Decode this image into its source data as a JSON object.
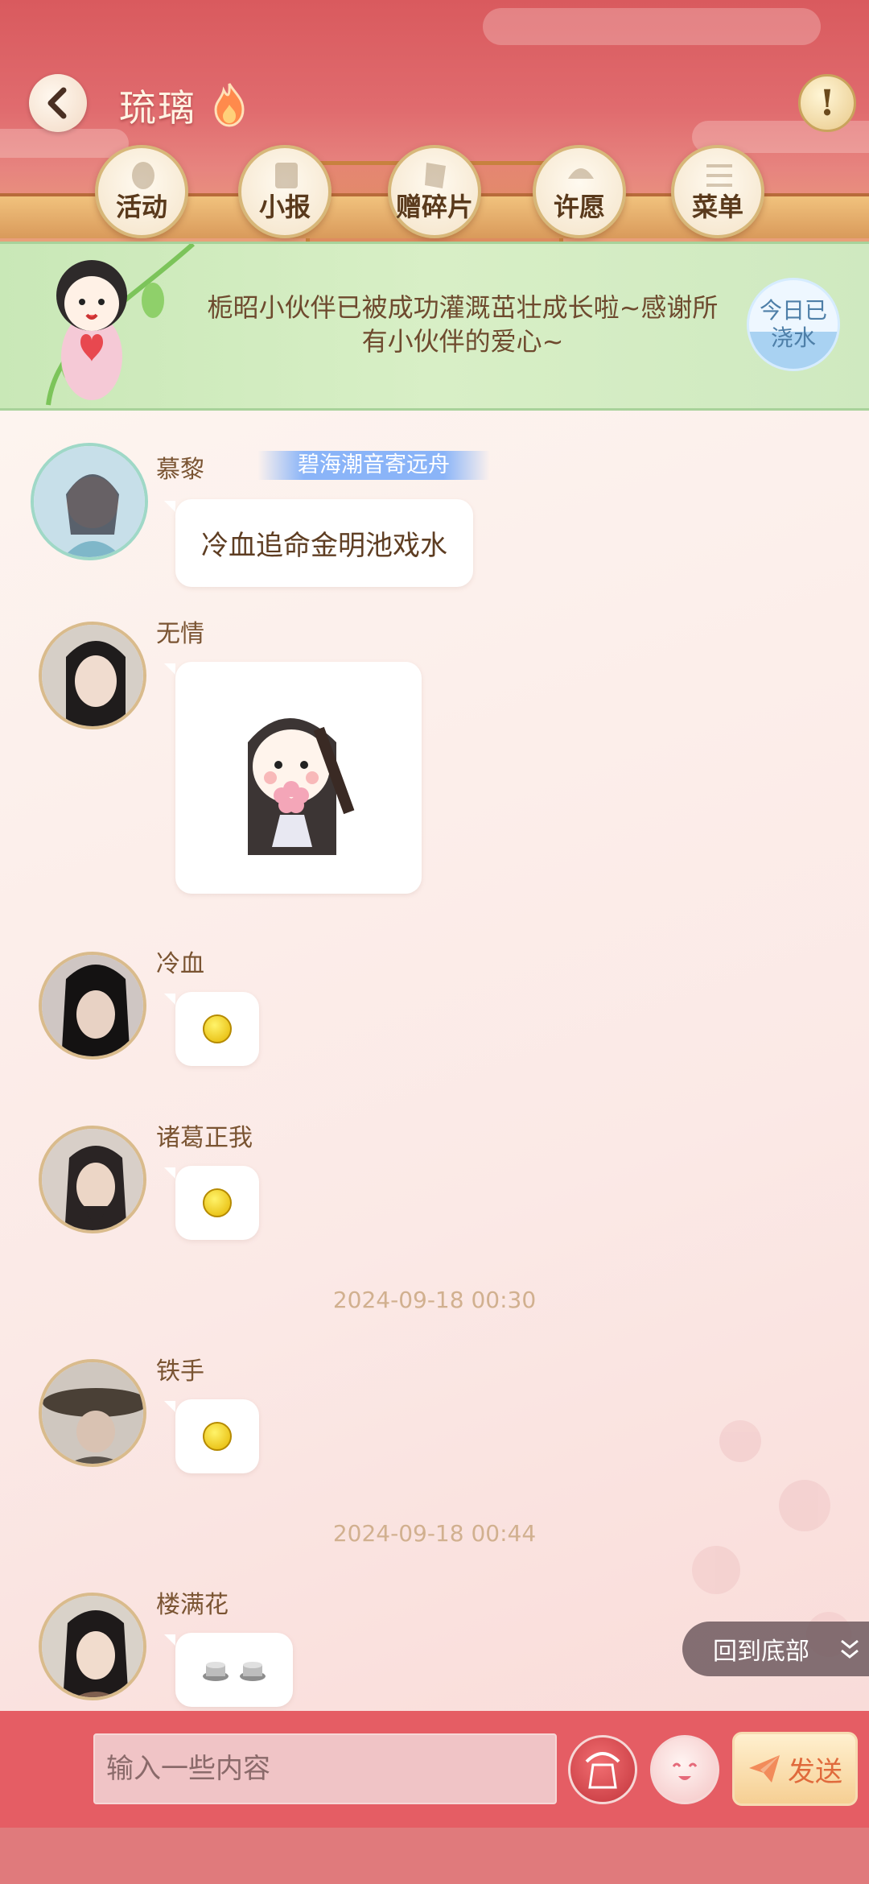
{
  "header": {
    "title": "琉璃",
    "back_icon": "back-arrow-icon",
    "alert_icon": "exclamation-icon",
    "alert_label": "!",
    "nav": [
      {
        "label": "活动",
        "icon": "lantern-icon"
      },
      {
        "label": "小报",
        "icon": "scroll-icon"
      },
      {
        "label": "赠碎片",
        "icon": "fragment-icon"
      },
      {
        "label": "许愿",
        "icon": "fountain-icon"
      },
      {
        "label": "菜单",
        "icon": "menu-icon"
      }
    ]
  },
  "banner": {
    "text": "栀昭小伙伴已被成功灌溉茁壮成长啦~感谢所有小伙伴的爱心~",
    "badge": "今日已浇水"
  },
  "messages": [
    {
      "sender": "慕黎",
      "title_tag": "碧海潮音寄远舟",
      "text": "冷血追命金明池戏水"
    },
    {
      "sender": "无情",
      "type": "sticker"
    },
    {
      "sender": "冷血",
      "type": "emoji"
    },
    {
      "sender": "诸葛正我",
      "type": "emoji"
    },
    {
      "sender": "铁手",
      "type": "emoji"
    },
    {
      "sender": "楼满花",
      "type": "emoji-pair"
    }
  ],
  "timestamps": [
    "2024-09-18 00:30",
    "2024-09-18 00:44"
  ],
  "scroll_bottom": {
    "label": "回到底部"
  },
  "input": {
    "placeholder": "输入一些内容",
    "send_label": "发送"
  },
  "colors": {
    "header_red": "#d95a5e",
    "banner_green": "#d8efc6",
    "input_bar": "#e55d64",
    "send_text": "#e06a3c"
  }
}
